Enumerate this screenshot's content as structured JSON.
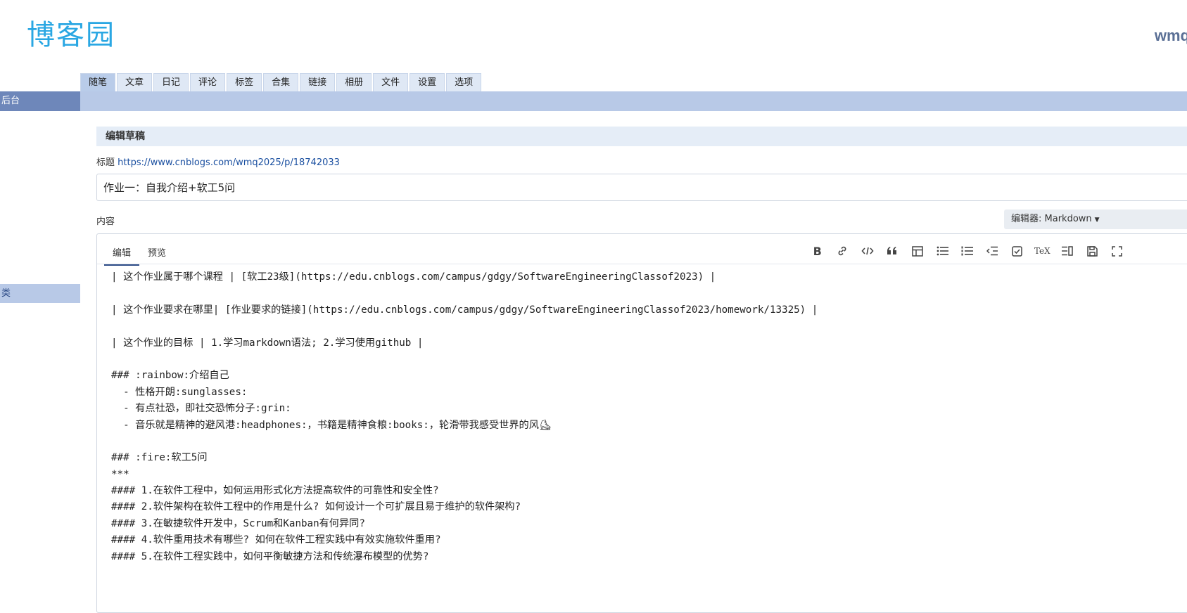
{
  "header": {
    "logo_text": "博客园",
    "user": "wmq"
  },
  "tabs": [
    "随笔",
    "文章",
    "日记",
    "评论",
    "标签",
    "合集",
    "链接",
    "相册",
    "文件",
    "设置",
    "选项"
  ],
  "sidebar": {
    "head": "后台",
    "item": "类"
  },
  "section": {
    "title": "编辑草稿"
  },
  "title_field": {
    "label": "标题",
    "url": "https://www.cnblogs.com/wmq2025/p/18742033",
    "value": "作业一：自我介绍+软工5问"
  },
  "content": {
    "label": "内容",
    "editor_select": "编辑器: Markdown"
  },
  "editor": {
    "tab_edit": "编辑",
    "tab_preview": "预览",
    "toolbar_icons": [
      "bold-icon",
      "link-icon",
      "code-icon",
      "quote-icon",
      "table-icon",
      "bullet-list-icon",
      "numbered-list-icon",
      "outdent-icon",
      "checkbox-icon",
      "tex-icon",
      "toc-icon",
      "save-icon",
      "fullscreen-icon"
    ],
    "lines": [
      "| 这个作业属于哪个课程 | [软工23级](https://edu.cnblogs.com/campus/gdgy/SoftwareEngineeringClassof2023) |",
      "",
      "| 这个作业要求在哪里| [作业要求的链接](https://edu.cnblogs.com/campus/gdgy/SoftwareEngineeringClassof2023/homework/13325) |",
      "",
      "| 这个作业的目标 | 1.学习markdown语法; 2.学习使用github |",
      "",
      "### :rainbow:介绍自己",
      "  - 性格开朗:sunglasses:",
      "  - 有点社恐，即社交恐怖分子:grin:",
      "  - 音乐就是精神的避风港:headphones:，书籍是精神食粮:books:，轮滑带我感受世界的风⛸",
      "",
      "### :fire:软工5问",
      "***",
      "#### 1.在软件工程中，如何运用形式化方法提高软件的可靠性和安全性?",
      "#### 2.软件架构在软件工程中的作用是什么? 如何设计一个可扩展且易于维护的软件架构?",
      "#### 3.在敏捷软件开发中，Scrum和Kanban有何异同?",
      "#### 4.软件重用技术有哪些? 如何在软件工程实践中有效实施软件重用?",
      "#### 5.在软件工程实践中，如何平衡敏捷方法和传统瀑布模型的优势?"
    ]
  }
}
